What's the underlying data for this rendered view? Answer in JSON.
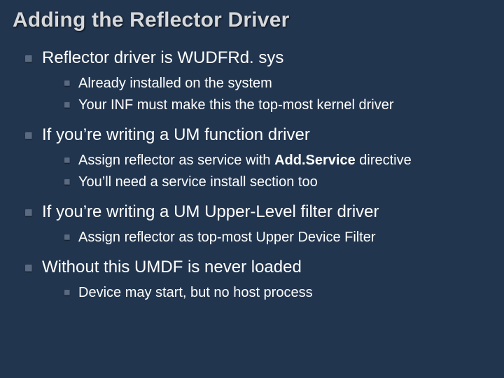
{
  "title": "Adding the Reflector Driver",
  "bullets": [
    {
      "text": "Reflector driver is WUDFRd. sys",
      "sub": [
        "Already installed on the system",
        "Your INF must make this the top-most kernel driver"
      ]
    },
    {
      "text": "If you’re writing a UM function driver",
      "sub_parts": [
        {
          "pre": "Assign reflector as service with ",
          "bold": "Add.Service",
          "post": " directive"
        }
      ],
      "sub": [
        "Assign reflector as service with Add.Service directive",
        "You’ll need a service install section too"
      ]
    },
    {
      "text": "If you’re writing a UM Upper-Level filter driver",
      "sub": [
        "Assign reflector as top-most Upper Device Filter"
      ]
    },
    {
      "text": "Without this UMDF is never loaded",
      "sub": [
        "Device may start, but no host process"
      ]
    }
  ]
}
